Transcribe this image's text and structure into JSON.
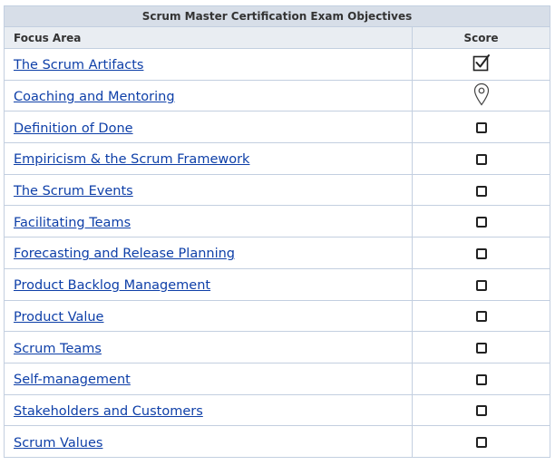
{
  "table": {
    "title": "Scrum Master Certification Exam Objectives",
    "col_focus": "Focus Area",
    "col_score": "Score",
    "rows": [
      {
        "label": "The Scrum Artifacts",
        "score_icon": "checked-box-icon"
      },
      {
        "label": "Coaching and Mentoring",
        "score_icon": "location-pin-icon"
      },
      {
        "label": "Definition of Done",
        "score_icon": "empty-box-icon"
      },
      {
        "label": "Empiricism & the Scrum Framework",
        "score_icon": "empty-box-icon"
      },
      {
        "label": "The Scrum Events",
        "score_icon": "empty-box-icon"
      },
      {
        "label": "Facilitating Teams",
        "score_icon": "empty-box-icon"
      },
      {
        "label": "Forecasting and Release Planning",
        "score_icon": "empty-box-icon"
      },
      {
        "label": "Product Backlog Management",
        "score_icon": "empty-box-icon"
      },
      {
        "label": "Product Value",
        "score_icon": "empty-box-icon"
      },
      {
        "label": "Scrum Teams",
        "score_icon": "empty-box-icon"
      },
      {
        "label": "Self-management",
        "score_icon": "empty-box-icon"
      },
      {
        "label": "Stakeholders and Customers",
        "score_icon": "empty-box-icon"
      },
      {
        "label": "Scrum Values",
        "score_icon": "empty-box-icon"
      }
    ]
  },
  "colors": {
    "link": "#0e3fa8",
    "title_bg": "#d7dee8",
    "header_bg": "#e9edf2",
    "border": "#c3cfe0"
  }
}
